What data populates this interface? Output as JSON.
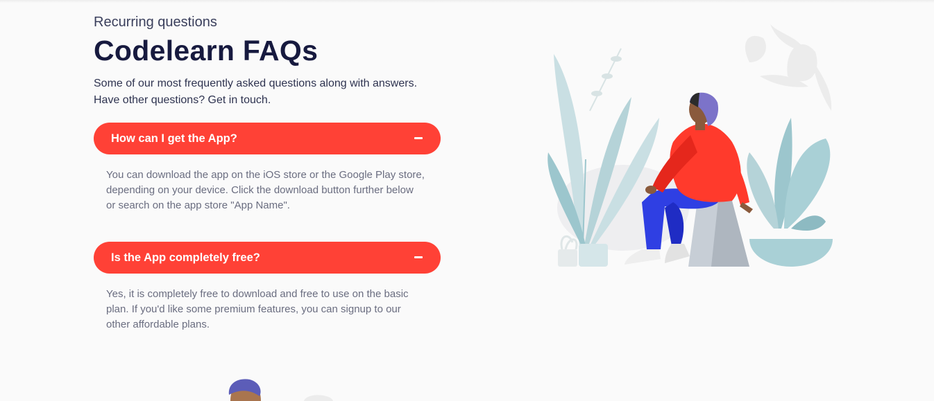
{
  "header": {
    "eyebrow": "Recurring questions",
    "title": "Codelearn FAQs",
    "intro": "Some of our most frequently asked questions along with answers. Have other questions? Get in touch."
  },
  "faqs": [
    {
      "question": "How can I get the App?",
      "answer": "You can download the app on the iOS store or the Google Play store, depending on your device. Click the download button further below or search on the app store \"App Name\".",
      "toggle_icon": "minus-icon"
    },
    {
      "question": "Is the App completely free?",
      "answer": "Yes, it is completely free to download and free to use on the basic plan. If you'd like some premium features, you can signup to our other affordable plans.",
      "toggle_icon": "minus-icon"
    }
  ],
  "colors": {
    "accent": "#ff4136",
    "title": "#171a3f",
    "body_text": "#2e3350",
    "answer_text": "#6a6d80",
    "background": "#fafafa"
  },
  "illustrations": {
    "main": "person-sitting-with-plants-illustration",
    "footer": "person-avatar-illustration"
  }
}
